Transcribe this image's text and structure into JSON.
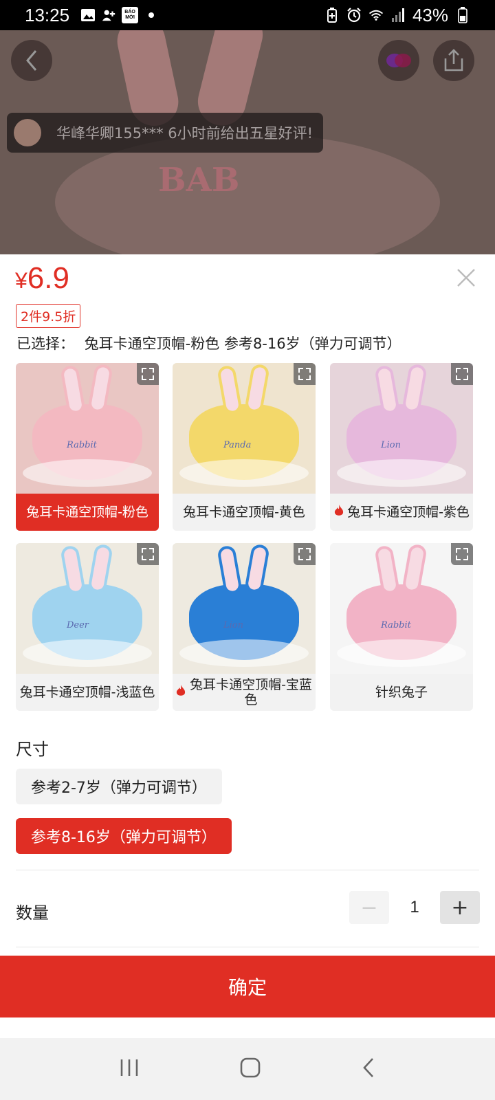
{
  "status_bar": {
    "time": "13:25",
    "notif_label": "BÁO MỚI",
    "battery": "43%"
  },
  "toast": {
    "text": "华峰华卿155*** 6小时前给出五星好评!"
  },
  "hero": {
    "image_text": "BAB"
  },
  "sku": {
    "currency": "¥",
    "price": "6.9",
    "discount_tag": "2件9.5折",
    "selected_label": "已选择：",
    "selected_value": "兔耳卡通空顶帽-粉色 参考8-16岁（弹力可调节）",
    "options": [
      {
        "label": "兔耳卡通空顶帽-粉色",
        "hot": false,
        "active": true,
        "hat_color": "#f3b9c1",
        "bg_color": "#e9c6c3",
        "image_text": "Rabbit"
      },
      {
        "label": "兔耳卡通空顶帽-黄色",
        "hot": false,
        "active": false,
        "hat_color": "#f3d86a",
        "bg_color": "#efe4cf",
        "image_text": "Panda"
      },
      {
        "label": "兔耳卡通空顶帽-紫色",
        "hot": true,
        "active": false,
        "hat_color": "#e6b8dc",
        "bg_color": "#e6d4da",
        "image_text": "Lion"
      },
      {
        "label": "兔耳卡通空顶帽-浅蓝色",
        "hot": false,
        "active": false,
        "hat_color": "#9fd3ef",
        "bg_color": "#eeeae0",
        "image_text": "Deer"
      },
      {
        "label": "兔耳卡通空顶帽-宝蓝色",
        "hot": true,
        "active": false,
        "hat_color": "#2a7fd6",
        "bg_color": "#eeeae0",
        "image_text": "Lion"
      },
      {
        "label": "针织兔子",
        "hot": false,
        "active": false,
        "hat_color": "#f2b3c6",
        "bg_color": "#f5f5f5",
        "image_text": "Rabbit"
      }
    ],
    "size_title": "尺寸",
    "sizes": [
      {
        "label": "参考2-7岁（弹力可调节）",
        "active": false
      },
      {
        "label": "参考8-16岁（弹力可调节）",
        "active": true
      }
    ],
    "quantity_label": "数量",
    "quantity": "1",
    "minus": "−",
    "plus": "+",
    "confirm_label": "确定"
  },
  "colors": {
    "accent": "#e02e24"
  }
}
